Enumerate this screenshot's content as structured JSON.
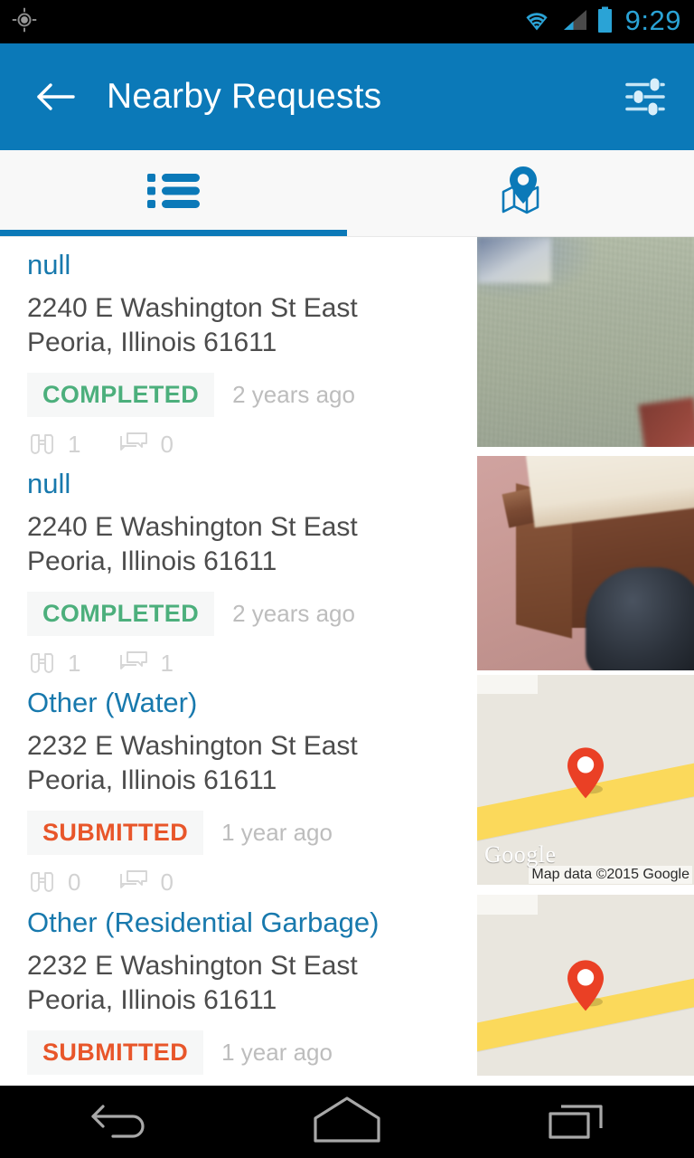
{
  "statusbar": {
    "gps_icon": "gps-fixed-icon",
    "wifi_icon": "wifi-icon",
    "signal_icon": "cell-signal-icon",
    "battery_icon": "battery-icon",
    "clock": "9:29",
    "clock_color": "#2aa3d6",
    "background": "#000000"
  },
  "appbar": {
    "back_icon": "back-arrow-icon",
    "title": "Nearby Requests",
    "filter_icon": "filter-sliders-icon",
    "background": "#0b79b8",
    "text_color": "#ffffff"
  },
  "tabs": [
    {
      "name": "list",
      "icon": "list-icon",
      "active": true
    },
    {
      "name": "map",
      "icon": "map-pin-icon",
      "active": false
    }
  ],
  "tab_accent": "#0b79b8",
  "colors": {
    "title_link": "#1879ad",
    "address": "#4c4c4c",
    "status_completed": "#4caf7c",
    "status_submitted": "#e8562a",
    "timestamp": "#bdbdbd",
    "count": "#d2d2d2",
    "badge_bg": "#f6f7f7"
  },
  "requests": [
    {
      "title": "null",
      "address_line1": "2240  E Washington St East",
      "address_line2": "Peoria, Illinois 61611",
      "status": "COMPLETED",
      "status_type": "completed",
      "time_ago": "2 years ago",
      "watch_count": "1",
      "comment_count": "0",
      "thumb_type": "photo-carpet"
    },
    {
      "title": "null",
      "address_line1": "2240  E Washington St East",
      "address_line2": "Peoria, Illinois 61611",
      "status": "COMPLETED",
      "status_type": "completed",
      "time_ago": "2 years ago",
      "watch_count": "1",
      "comment_count": "1",
      "thumb_type": "photo-desk"
    },
    {
      "title": "Other (Water)",
      "address_line1": "2232  E Washington St East",
      "address_line2": "Peoria, Illinois 61611",
      "status": "SUBMITTED",
      "status_type": "submitted",
      "time_ago": "1 year ago",
      "watch_count": "0",
      "comment_count": "0",
      "thumb_type": "map",
      "map_watermark": "Google",
      "map_attribution": "Map data ©2015 Google"
    },
    {
      "title": "Other (Residential Garbage)",
      "address_line1": "2232  E Washington St East",
      "address_line2": "Peoria, Illinois 61611",
      "status": "SUBMITTED",
      "status_type": "submitted",
      "time_ago": "1 year ago",
      "watch_count": "",
      "comment_count": "",
      "thumb_type": "map",
      "map_watermark": "",
      "map_attribution": ""
    }
  ],
  "navbar": {
    "back_icon": "nav-back-icon",
    "home_icon": "nav-home-icon",
    "recents_icon": "nav-recents-icon",
    "background": "#000000"
  }
}
